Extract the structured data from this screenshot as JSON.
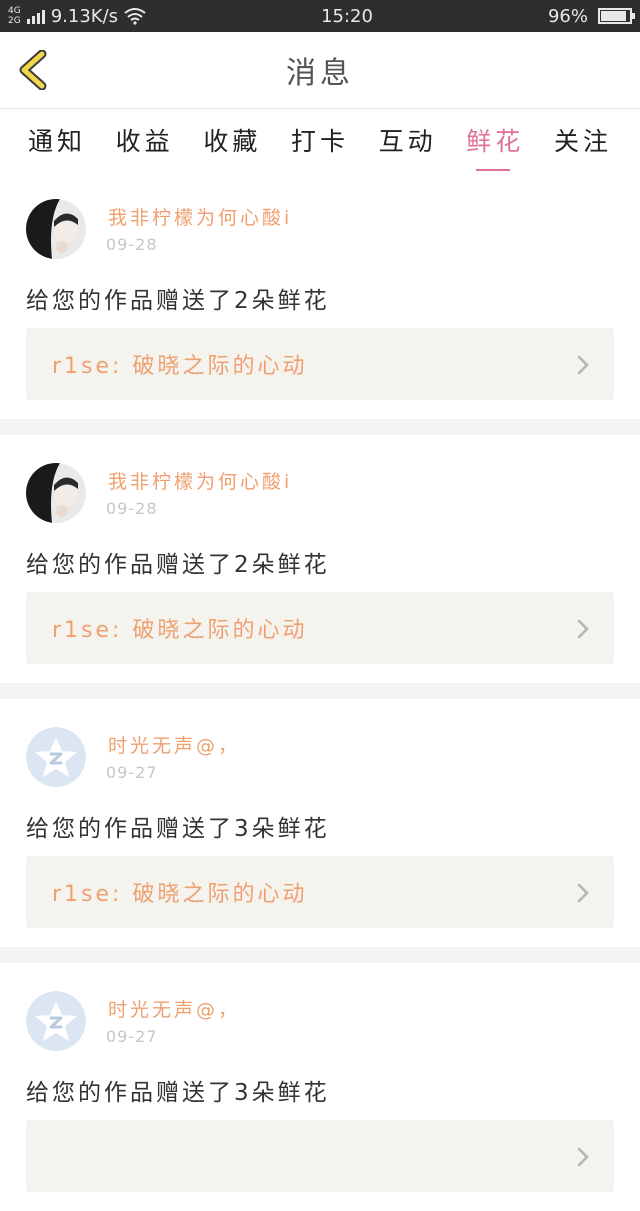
{
  "status_bar": {
    "network_top": "4G",
    "network_bottom": "2G",
    "speed": "9.13K/s",
    "time": "15:20",
    "battery": "96%",
    "battery_level": 0.96
  },
  "header": {
    "title": "消息"
  },
  "tabs": [
    {
      "label": "通知",
      "active": false
    },
    {
      "label": "收益",
      "active": false
    },
    {
      "label": "收藏",
      "active": false
    },
    {
      "label": "打卡",
      "active": false
    },
    {
      "label": "互动",
      "active": false
    },
    {
      "label": "鲜花",
      "active": true
    },
    {
      "label": "关注",
      "active": false
    }
  ],
  "messages": [
    {
      "user": "我非柠檬为何心酸i",
      "date": "09-28",
      "text": "给您的作品赠送了2朵鲜花",
      "work": "r1se: 破晓之际的心动",
      "avatar": "photo"
    },
    {
      "user": "我非柠檬为何心酸i",
      "date": "09-28",
      "text": "给您的作品赠送了2朵鲜花",
      "work": "r1se: 破晓之际的心动",
      "avatar": "photo"
    },
    {
      "user": "时光无声@，",
      "date": "09-27",
      "text": "给您的作品赠送了3朵鲜花",
      "work": "r1se: 破晓之际的心动",
      "avatar": "default-star"
    },
    {
      "user": "时光无声@，",
      "date": "09-27",
      "text": "给您的作品赠送了3朵鲜花",
      "work": "",
      "avatar": "default-star"
    }
  ],
  "colors": {
    "accent": "#e0709a",
    "username": "#f0a070",
    "back_arrow": "#f0d64a"
  }
}
